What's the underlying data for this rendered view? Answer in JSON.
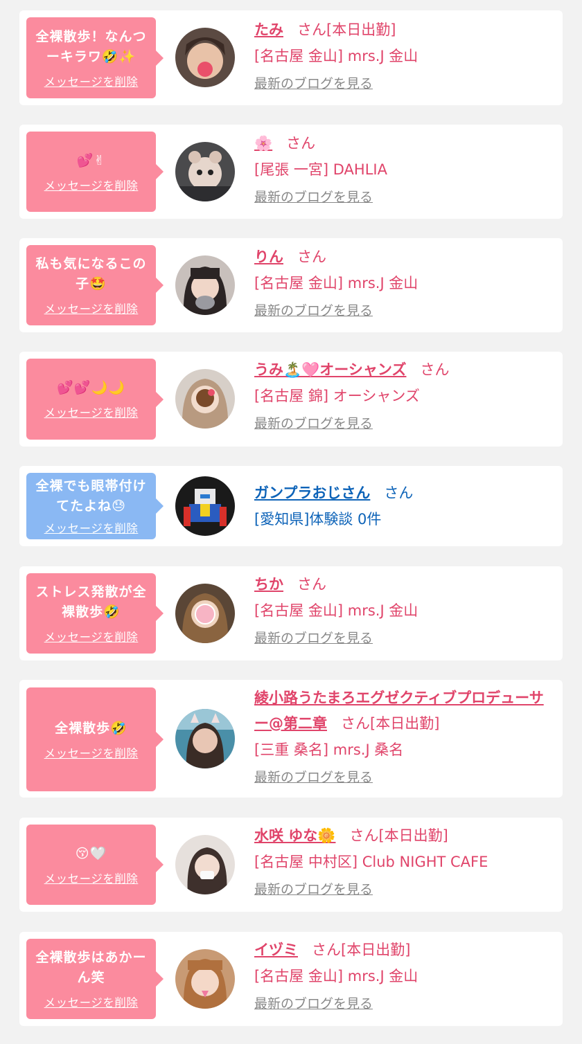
{
  "delete_label": "メッセージを削除",
  "blog_label": "最新のブログを見る",
  "colors": {
    "accent": "#e0446a",
    "bubble_pink": "#fb8b9e",
    "bubble_blue": "#8ab8f3",
    "link_blue": "#0d63b8"
  },
  "items": [
    {
      "message": "全裸散歩！なんつーキラワ🤣✨",
      "name": "たみ",
      "suffix": "さん[本日出勤]",
      "shop": "[名古屋 金山] mrs.J 金山",
      "avatar": "avatar-photo-icon"
    },
    {
      "message": "💕✌",
      "name": "🌸",
      "suffix": "さん",
      "shop": "[尾張 一宮] DAHLIA",
      "avatar": "avatar-photo-icon"
    },
    {
      "message": "私も気になるこの子🤩",
      "name": "りん",
      "suffix": "さん",
      "shop": "[名古屋 金山] mrs.J 金山",
      "avatar": "avatar-photo-icon"
    },
    {
      "message": "💕💕🌙🌙",
      "name": "うみ🏝️🩷オーシャンズ",
      "suffix": "さん",
      "shop": "[名古屋 錦] オーシャンズ",
      "avatar": "avatar-photo-icon"
    },
    {
      "message": "全裸でも眼帯付けてたよね😓",
      "name": "ガンプラおじさん",
      "suffix": "さん",
      "shop": "[愛知県]体験談 0件",
      "avatar": "avatar-photo-icon"
    },
    {
      "message": "ストレス発散が全裸散歩🤣",
      "name": "ちか",
      "suffix": "さん",
      "shop": "[名古屋 金山] mrs.J 金山",
      "avatar": "avatar-photo-icon"
    },
    {
      "message": "全裸散歩🤣",
      "name": "綾小路うたまろエグゼクティブプロデューサー@第二章",
      "suffix": "さん[本日出勤]",
      "shop": "[三重 桑名] mrs.J 桑名",
      "avatar": "avatar-photo-icon"
    },
    {
      "message": "😚🤍",
      "name": "水咲 ゆな🌼",
      "suffix": "さん[本日出勤]",
      "shop": "[名古屋 中村区] Club NIGHT CAFE",
      "avatar": "avatar-photo-icon"
    },
    {
      "message": "全裸散歩はあかーん笑",
      "name": "イヅミ",
      "suffix": "さん[本日出勤]",
      "shop": "[名古屋 金山] mrs.J 金山",
      "avatar": "avatar-photo-icon"
    }
  ]
}
